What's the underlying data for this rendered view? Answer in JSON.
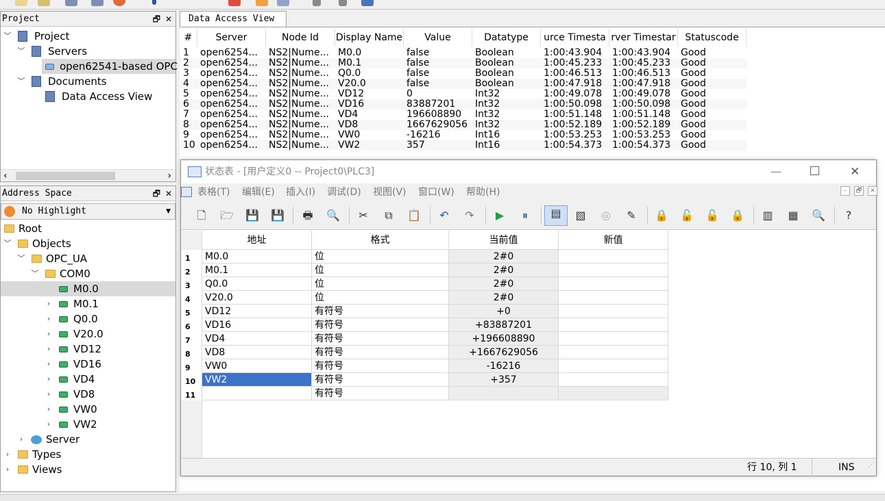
{
  "project_panel": {
    "title": "Project",
    "tree": {
      "project": "Project",
      "servers": "Servers",
      "server_item": "open62541-based OPC",
      "documents": "Documents",
      "data_access_view": "Data Access View"
    }
  },
  "address_panel": {
    "title": "Address Space",
    "highlight_select": "No Highlight",
    "tree": {
      "root": "Root",
      "objects": "Objects",
      "opc_ua": "OPC_UA",
      "com0": "COM0",
      "nodes": [
        "M0.0",
        "M0.1",
        "Q0.0",
        "V20.0",
        "VD12",
        "VD16",
        "VD4",
        "VD8",
        "VW0",
        "VW2"
      ],
      "server": "Server",
      "types": "Types",
      "views": "Views"
    }
  },
  "data_access_view": {
    "tab_label": "Data Access View",
    "headers": [
      "#",
      "Server",
      "Node Id",
      "Display Name",
      "Value",
      "Datatype",
      "urce Timesta",
      "rver Timestar",
      "Statuscode"
    ],
    "rows": [
      [
        "1",
        "open6254...",
        "NS2|Nume...",
        "M0.0",
        "false",
        "Boolean",
        "1:00:43.904",
        "1:00:43.904",
        "Good"
      ],
      [
        "2",
        "open6254...",
        "NS2|Nume...",
        "M0.1",
        "false",
        "Boolean",
        "1:00:45.233",
        "1:00:45.233",
        "Good"
      ],
      [
        "3",
        "open6254...",
        "NS2|Nume...",
        "Q0.0",
        "false",
        "Boolean",
        "1:00:46.513",
        "1:00:46.513",
        "Good"
      ],
      [
        "4",
        "open6254...",
        "NS2|Nume...",
        "V20.0",
        "false",
        "Boolean",
        "1:00:47.918",
        "1:00:47.918",
        "Good"
      ],
      [
        "5",
        "open6254...",
        "NS2|Nume...",
        "VD12",
        "0",
        "Int32",
        "1:00:49.078",
        "1:00:49.078",
        "Good"
      ],
      [
        "6",
        "open6254...",
        "NS2|Nume...",
        "VD16",
        "83887201",
        "Int32",
        "1:00:50.098",
        "1:00:50.098",
        "Good"
      ],
      [
        "7",
        "open6254...",
        "NS2|Nume...",
        "VD4",
        "196608890",
        "Int32",
        "1:00:51.148",
        "1:00:51.148",
        "Good"
      ],
      [
        "8",
        "open6254...",
        "NS2|Nume...",
        "VD8",
        "1667629056",
        "Int32",
        "1:00:52.189",
        "1:00:52.189",
        "Good"
      ],
      [
        "9",
        "open6254...",
        "NS2|Nume...",
        "VW0",
        "-16216",
        "Int16",
        "1:00:53.253",
        "1:00:53.253",
        "Good"
      ],
      [
        "10",
        "open6254...",
        "NS2|Nume...",
        "VW2",
        "357",
        "Int16",
        "1:00:54.373",
        "1:00:54.373",
        "Good"
      ]
    ]
  },
  "status_window": {
    "title": "状态表 - [用户定义0 -- Project0\\PLC3]",
    "menu": [
      "表格(T)",
      "编辑(E)",
      "插入(I)",
      "调试(D)",
      "视图(V)",
      "窗口(W)",
      "帮助(H)"
    ],
    "headers": [
      "地址",
      "格式",
      "当前值",
      "新值"
    ],
    "rows": [
      {
        "n": "1",
        "addr": "M0.0",
        "fmt": "位",
        "cur": "2#0"
      },
      {
        "n": "2",
        "addr": "M0.1",
        "fmt": "位",
        "cur": "2#0"
      },
      {
        "n": "3",
        "addr": "Q0.0",
        "fmt": "位",
        "cur": "2#0"
      },
      {
        "n": "4",
        "addr": "V20.0",
        "fmt": "位",
        "cur": "2#0"
      },
      {
        "n": "5",
        "addr": "VD12",
        "fmt": "有符号",
        "cur": "+0"
      },
      {
        "n": "6",
        "addr": "VD16",
        "fmt": "有符号",
        "cur": "+83887201"
      },
      {
        "n": "7",
        "addr": "VD4",
        "fmt": "有符号",
        "cur": "+196608890"
      },
      {
        "n": "8",
        "addr": "VD8",
        "fmt": "有符号",
        "cur": "+1667629056"
      },
      {
        "n": "9",
        "addr": "VW0",
        "fmt": "有符号",
        "cur": "-16216"
      },
      {
        "n": "10",
        "addr": "VW2",
        "fmt": "有符号",
        "cur": "+357"
      },
      {
        "n": "11",
        "addr": "",
        "fmt": "有符号",
        "cur": ""
      }
    ],
    "status_pos": "行 10, 列 1",
    "status_mode": "INS",
    "colors": {
      "selection": "#3c73c8",
      "current_value_bg": "#ededed"
    }
  }
}
